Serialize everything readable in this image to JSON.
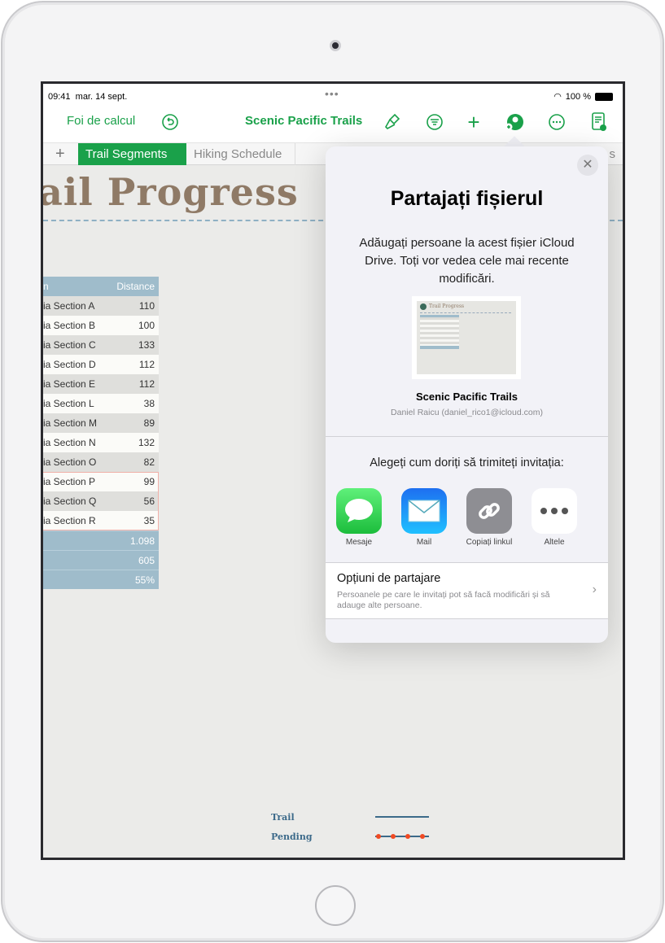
{
  "status": {
    "time": "09:41",
    "date": "mar. 14 sept.",
    "battery": "100 %"
  },
  "toolbar": {
    "back_label": "Foi de calcul",
    "doc_title": "Scenic Pacific Trails",
    "icons": [
      "undo-icon",
      "format-brush-icon",
      "sort-filter-icon",
      "add-icon",
      "collaborate-icon",
      "more-icon",
      "reader-view-icon"
    ]
  },
  "tabs": {
    "items": [
      {
        "label": "Trail Segments",
        "active": true
      },
      {
        "label": "Hiking Schedule",
        "active": false
      }
    ],
    "partial_label": "s"
  },
  "sheet": {
    "title": "ail Progress",
    "table": {
      "headers": [
        "n",
        "Distance"
      ],
      "rows": [
        [
          "ia Section A",
          "110"
        ],
        [
          "ia Section B",
          "100"
        ],
        [
          "ia Section C",
          "133"
        ],
        [
          "ia Section D",
          "112"
        ],
        [
          "ia Section E",
          "112"
        ],
        [
          "ia Section L",
          "38"
        ],
        [
          "ia Section M",
          "89"
        ],
        [
          "ia Section N",
          "132"
        ],
        [
          "ia Section O",
          "82"
        ],
        [
          "ia Section P",
          "99"
        ],
        [
          "ia Section Q",
          "56"
        ],
        [
          "ia Section R",
          "35"
        ]
      ],
      "summary": [
        "1.098",
        "605",
        "55%"
      ]
    },
    "legend": [
      {
        "label": "Trail",
        "style": "solid"
      },
      {
        "label": "Pending",
        "style": "dotted"
      }
    ]
  },
  "share": {
    "title": "Partajați fișierul",
    "description": "Adăugați persoane la acest fișier iCloud Drive. Toți vor vedea cele mai recente modificări.",
    "thumbnail_title": "Trail Progress",
    "file_name": "Scenic Pacific Trails",
    "owner": "Daniel Raicu (daniel_rico1@icloud.com)",
    "choose_label": "Alegeți cum doriți să trimiteți invitația:",
    "apps": [
      {
        "label": "Mesaje",
        "color": "#34c759"
      },
      {
        "label": "Mail",
        "color": "#1a8cff"
      },
      {
        "label": "Copiați linkul",
        "color": "#8e8e93"
      },
      {
        "label": "Altele",
        "color": "#ffffff"
      }
    ],
    "options_title": "Opțiuni de partajare",
    "options_subtitle": "Persoanele pe care le invitați pot să facă modificări și să adauge alte persoane."
  },
  "colors": {
    "accent": "#1aa14a",
    "header": "#9fbccb",
    "title_brown": "#8f7a66"
  }
}
